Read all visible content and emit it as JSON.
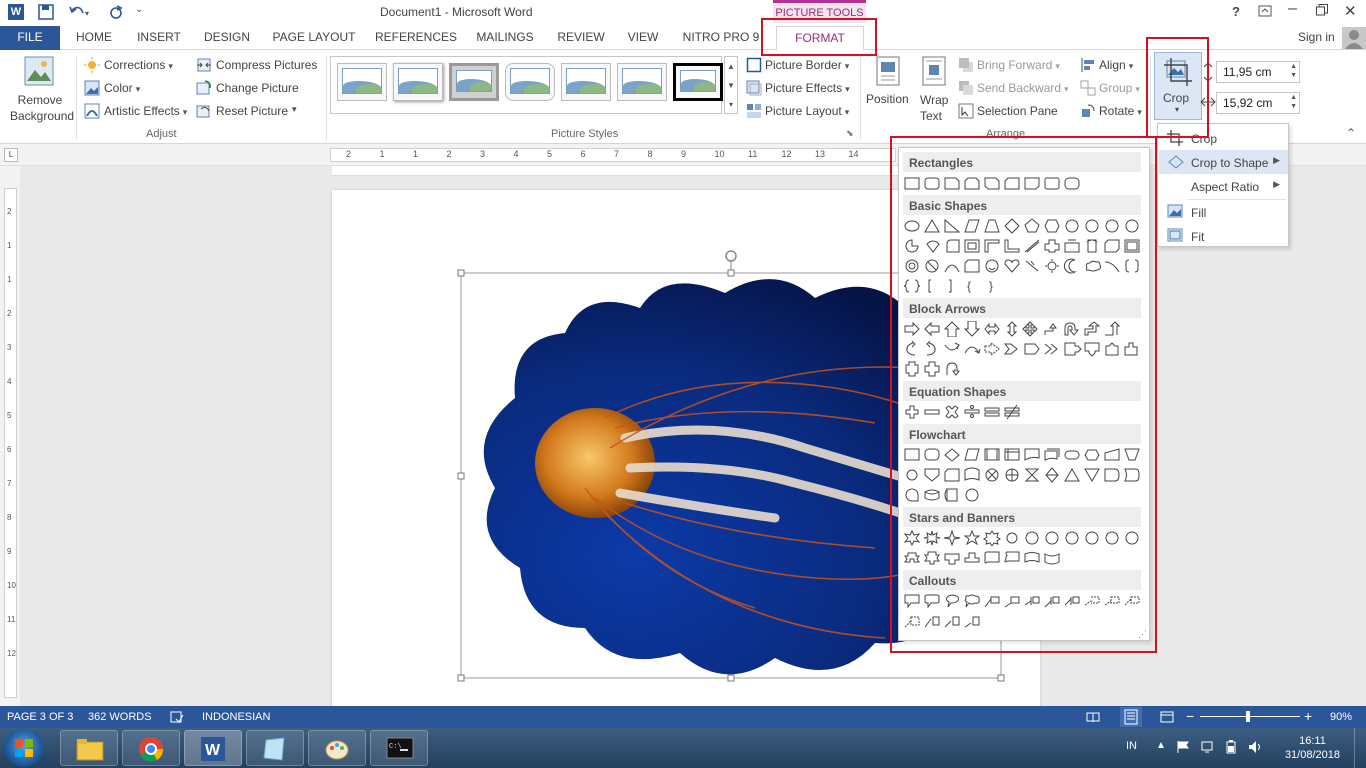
{
  "window": {
    "title": "Document1 - Microsoft Word",
    "contextual_tab_group": "PICTURE TOOLS",
    "help": "?",
    "signin": "Sign in"
  },
  "tabs": [
    "FILE",
    "HOME",
    "INSERT",
    "DESIGN",
    "PAGE LAYOUT",
    "REFERENCES",
    "MAILINGS",
    "REVIEW",
    "VIEW",
    "NITRO PRO 9",
    "FORMAT"
  ],
  "active_tab": "FORMAT",
  "ribbon": {
    "remove_background": "Remove Background",
    "remove_background_l1": "Remove",
    "remove_background_l2": "Background",
    "adjust": {
      "corrections": "Corrections",
      "color": "Color",
      "artistic_effects": "Artistic Effects",
      "compress_pictures": "Compress Pictures",
      "change_picture": "Change Picture",
      "reset_picture": "Reset Picture",
      "group_label": "Adjust"
    },
    "picture_styles": {
      "group_label": "Picture Styles",
      "picture_border": "Picture Border",
      "picture_effects": "Picture Effects",
      "picture_layout": "Picture Layout"
    },
    "arrange": {
      "position": "Position",
      "wrap_text_l1": "Wrap",
      "wrap_text_l2": "Text",
      "bring_forward": "Bring Forward",
      "send_backward": "Send Backward",
      "selection_pane": "Selection Pane",
      "align": "Align",
      "group": "Group",
      "rotate": "Rotate",
      "group_label": "Arrange"
    },
    "size": {
      "crop": "Crop",
      "height": "11,95 cm",
      "width": "15,92 cm"
    }
  },
  "crop_menu": {
    "items": [
      "Crop",
      "Crop to Shape",
      "Aspect Ratio",
      "Fill",
      "Fit"
    ]
  },
  "shapes_panel": {
    "sections": [
      "Rectangles",
      "Basic Shapes",
      "Block Arrows",
      "Equation Shapes",
      "Flowchart",
      "Stars and Banners",
      "Callouts"
    ]
  },
  "ruler": {
    "h_ticks": [
      "2",
      "1",
      "1",
      "2",
      "3",
      "4",
      "5",
      "6",
      "7",
      "8",
      "9",
      "10",
      "11",
      "12",
      "13",
      "14"
    ],
    "v_ticks": [
      "2",
      "1",
      "1",
      "2",
      "3",
      "4",
      "5",
      "6",
      "7",
      "8",
      "9",
      "10",
      "11",
      "12"
    ]
  },
  "statusbar": {
    "page": "PAGE 3 OF 3",
    "words": "362 WORDS",
    "language": "INDONESIAN",
    "zoom": "90%"
  },
  "taskbar": {
    "lang": "IN",
    "time": "16:11",
    "date": "31/08/2018"
  },
  "colors": {
    "word_blue": "#2b579a",
    "format_accent": "#9b2c7a",
    "highlight_red": "#d6101e",
    "picture_bg": "#0b2a7a"
  }
}
